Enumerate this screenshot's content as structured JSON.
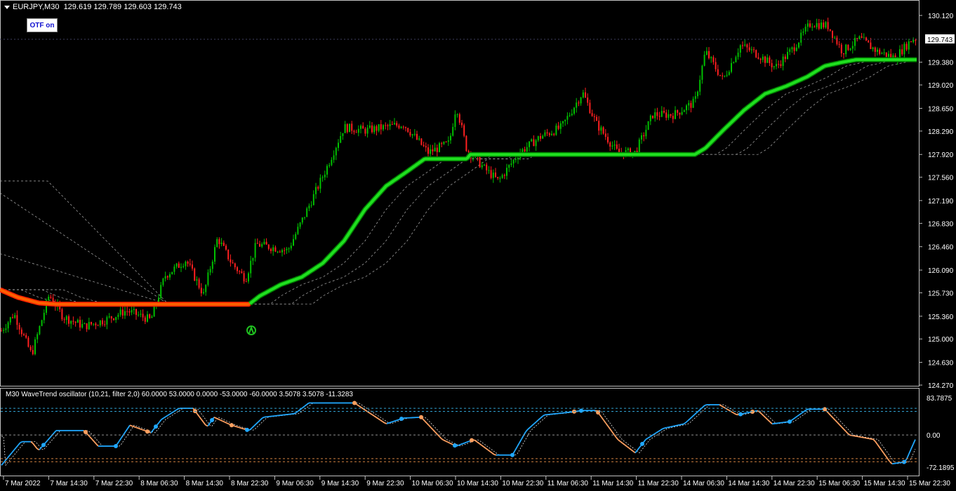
{
  "header": {
    "symbol": "EURJPY,M30",
    "ohlc": "129.619 129.789 129.603 129.743"
  },
  "otf_button": {
    "label": "OTF on"
  },
  "price_axis": {
    "ticks": [
      "130.120",
      "129.380",
      "129.020",
      "128.650",
      "128.290",
      "127.920",
      "127.560",
      "127.190",
      "126.830",
      "126.460",
      "126.090",
      "125.730",
      "125.360",
      "125.000",
      "124.630",
      "124.270"
    ],
    "current_price": "129.743"
  },
  "oscillator": {
    "label": "M30 WaveTrend oscillator (10,21, filter 2,0) 60.0000 53.0000 0.0000 -53.0000 -60.0000 3.5078 3.5078 -11.3283",
    "levels": [
      "83.7875",
      "0.00",
      "-72.1895"
    ]
  },
  "time_axis": {
    "labels": [
      "7 Mar 2022",
      "7 Mar 14:30",
      "7 Mar 22:30",
      "8 Mar 06:30",
      "8 Mar 14:30",
      "8 Mar 22:30",
      "9 Mar 06:30",
      "9 Mar 14:30",
      "9 Mar 22:30",
      "10 Mar 06:30",
      "10 Mar 14:30",
      "10 Mar 22:30",
      "11 Mar 06:30",
      "11 Mar 14:30",
      "11 Mar 22:30",
      "14 Mar 06:30",
      "14 Mar 14:30",
      "14 Mar 22:30",
      "15 Mar 06:30",
      "15 Mar 14:30",
      "15 Mar 22:30"
    ]
  },
  "colors": {
    "background": "#000000",
    "bull_candle": "#00c000",
    "bear_candle": "#ff2020",
    "trend_up": "#20e020",
    "trend_down": "#ff6000",
    "osc_up": "#20a8ff",
    "osc_down": "#ffa060",
    "grid_text": "#ffffff"
  },
  "icons": {
    "signal": "up-arrow-marker-icon"
  }
}
